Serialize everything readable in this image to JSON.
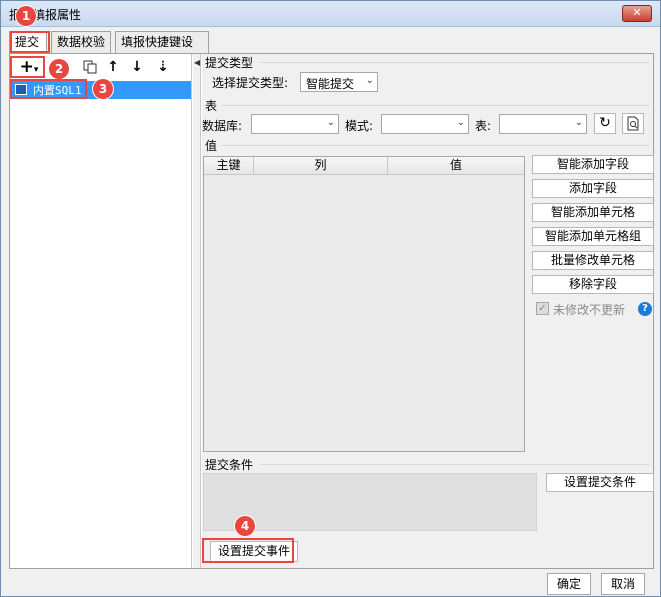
{
  "window": {
    "title": "报表填报属性",
    "close_label": "✕"
  },
  "tabs": [
    {
      "label": "提交"
    },
    {
      "label": "数据校验"
    },
    {
      "label": "填报快捷键设置"
    }
  ],
  "left_toolbar": {
    "add_label": "+",
    "add_arrow": "▾",
    "copy_icon": "copy-icon",
    "up_label": "↑",
    "down_label": "↓",
    "sort_label": "⇣"
  },
  "tree": {
    "items": [
      {
        "label": "内置SQL1"
      }
    ]
  },
  "submit_type": {
    "section_label": "提交类型",
    "field_label": "选择提交类型:",
    "value": "智能提交"
  },
  "table": {
    "section_label": "表",
    "database_label": "数据库:",
    "database_value": "",
    "schema_label": "模式:",
    "schema_value": "",
    "table_label": "表:",
    "table_value": ""
  },
  "values": {
    "section_label": "值",
    "columns": [
      "主键",
      "列",
      "值"
    ]
  },
  "side_buttons": [
    {
      "label": "智能添加字段"
    },
    {
      "label": "添加字段"
    },
    {
      "label": "智能添加单元格"
    },
    {
      "label": "智能添加单元格组"
    },
    {
      "label": "批量修改单元格"
    },
    {
      "label": "移除字段"
    }
  ],
  "no_update_unchanged": {
    "label": "未修改不更新",
    "checked": true
  },
  "submit_condition": {
    "section_label": "提交条件",
    "button_label": "设置提交条件"
  },
  "submit_event_button": "设置提交事件",
  "footer": {
    "ok_label": "确定",
    "cancel_label": "取消"
  },
  "annotations": [
    "1",
    "2",
    "3",
    "4"
  ],
  "colors": {
    "accent": "#e8463f",
    "selection": "#3399ff",
    "help": "#1a7bd8"
  }
}
